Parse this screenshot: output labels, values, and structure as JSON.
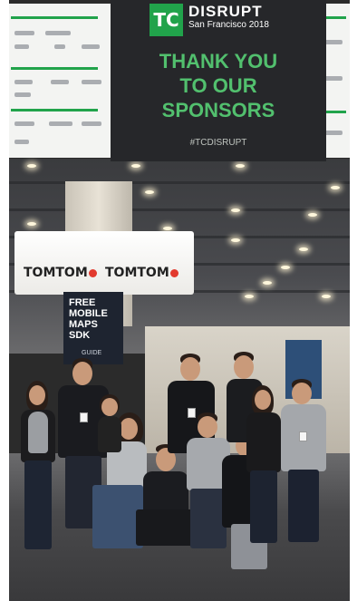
{
  "banner": {
    "logo": "TC",
    "event": "DISRUPT",
    "location": "San Francisco 2018",
    "lines": [
      "THANK YOU",
      "TO OUR",
      "SPONSORS"
    ],
    "hashtag": "#TCDISRUPT"
  },
  "kiosk": {
    "brand": "TOMTOM",
    "panel_lines": [
      "FREE",
      "MOBILE",
      "MAPS",
      "SDK"
    ],
    "panel_caption": "GUIDE"
  },
  "colors": {
    "banner_green": "#52c06e",
    "tc_green": "#21a34b",
    "banner_bg": "#26272a",
    "tomtom_red": "#e23a2e"
  }
}
